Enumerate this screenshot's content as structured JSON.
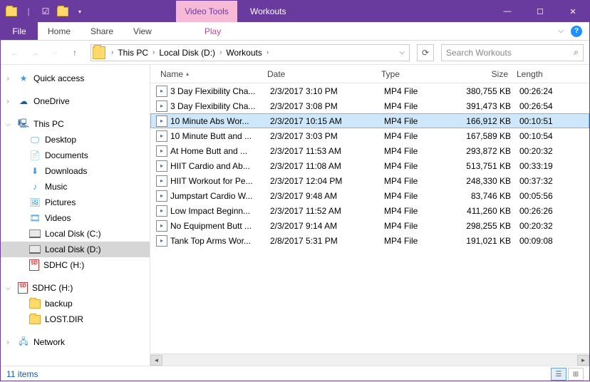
{
  "title": "Workouts",
  "contextTab": "Video Tools",
  "ribbonTabs": {
    "file": "File",
    "home": "Home",
    "share": "Share",
    "view": "View",
    "play": "Play"
  },
  "breadcrumb": [
    "This PC",
    "Local Disk (D:)",
    "Workouts"
  ],
  "searchPlaceholder": "Search Workouts",
  "columns": {
    "name": "Name",
    "date": "Date",
    "type": "Type",
    "size": "Size",
    "length": "Length"
  },
  "sidebar": {
    "quickAccess": "Quick access",
    "oneDrive": "OneDrive",
    "thisPC": "This PC",
    "desktop": "Desktop",
    "documents": "Documents",
    "downloads": "Downloads",
    "music": "Music",
    "pictures": "Pictures",
    "videos": "Videos",
    "localC": "Local Disk (C:)",
    "localD": "Local Disk (D:)",
    "sdhc1": "SDHC (H:)",
    "sdhc2": "SDHC (H:)",
    "backup": "backup",
    "lostdir": "LOST.DIR",
    "network": "Network"
  },
  "files": [
    {
      "name": "3 Day Flexibility Cha...",
      "date": "2/3/2017 3:10 PM",
      "type": "MP4 File",
      "size": "380,755 KB",
      "length": "00:26:24",
      "selected": false
    },
    {
      "name": "3 Day Flexibility Cha...",
      "date": "2/3/2017 3:08 PM",
      "type": "MP4 File",
      "size": "391,473 KB",
      "length": "00:26:54",
      "selected": false
    },
    {
      "name": "10 Minute Abs Wor...",
      "date": "2/3/2017 10:15 AM",
      "type": "MP4 File",
      "size": "166,912 KB",
      "length": "00:10:51",
      "selected": true
    },
    {
      "name": "10 Minute Butt and ...",
      "date": "2/3/2017 3:03 PM",
      "type": "MP4 File",
      "size": "167,589 KB",
      "length": "00:10:54",
      "selected": false
    },
    {
      "name": "At Home Butt and ...",
      "date": "2/3/2017 11:53 AM",
      "type": "MP4 File",
      "size": "293,872 KB",
      "length": "00:20:32",
      "selected": false
    },
    {
      "name": "HIIT Cardio and Ab...",
      "date": "2/3/2017 11:08 AM",
      "type": "MP4 File",
      "size": "513,751 KB",
      "length": "00:33:19",
      "selected": false
    },
    {
      "name": "HIIT Workout for Pe...",
      "date": "2/3/2017 12:04 PM",
      "type": "MP4 File",
      "size": "248,330 KB",
      "length": "00:37:32",
      "selected": false
    },
    {
      "name": "Jumpstart Cardio W...",
      "date": "2/3/2017 9:48 AM",
      "type": "MP4 File",
      "size": "83,746 KB",
      "length": "00:05:56",
      "selected": false
    },
    {
      "name": "Low Impact Beginn...",
      "date": "2/3/2017 11:52 AM",
      "type": "MP4 File",
      "size": "411,260 KB",
      "length": "00:26:26",
      "selected": false
    },
    {
      "name": "No Equipment Butt ...",
      "date": "2/3/2017 9:14 AM",
      "type": "MP4 File",
      "size": "298,255 KB",
      "length": "00:20:32",
      "selected": false
    },
    {
      "name": "Tank Top Arms Wor...",
      "date": "2/8/2017 5:31 PM",
      "type": "MP4 File",
      "size": "191,021 KB",
      "length": "00:09:08",
      "selected": false
    }
  ],
  "status": "11 items"
}
